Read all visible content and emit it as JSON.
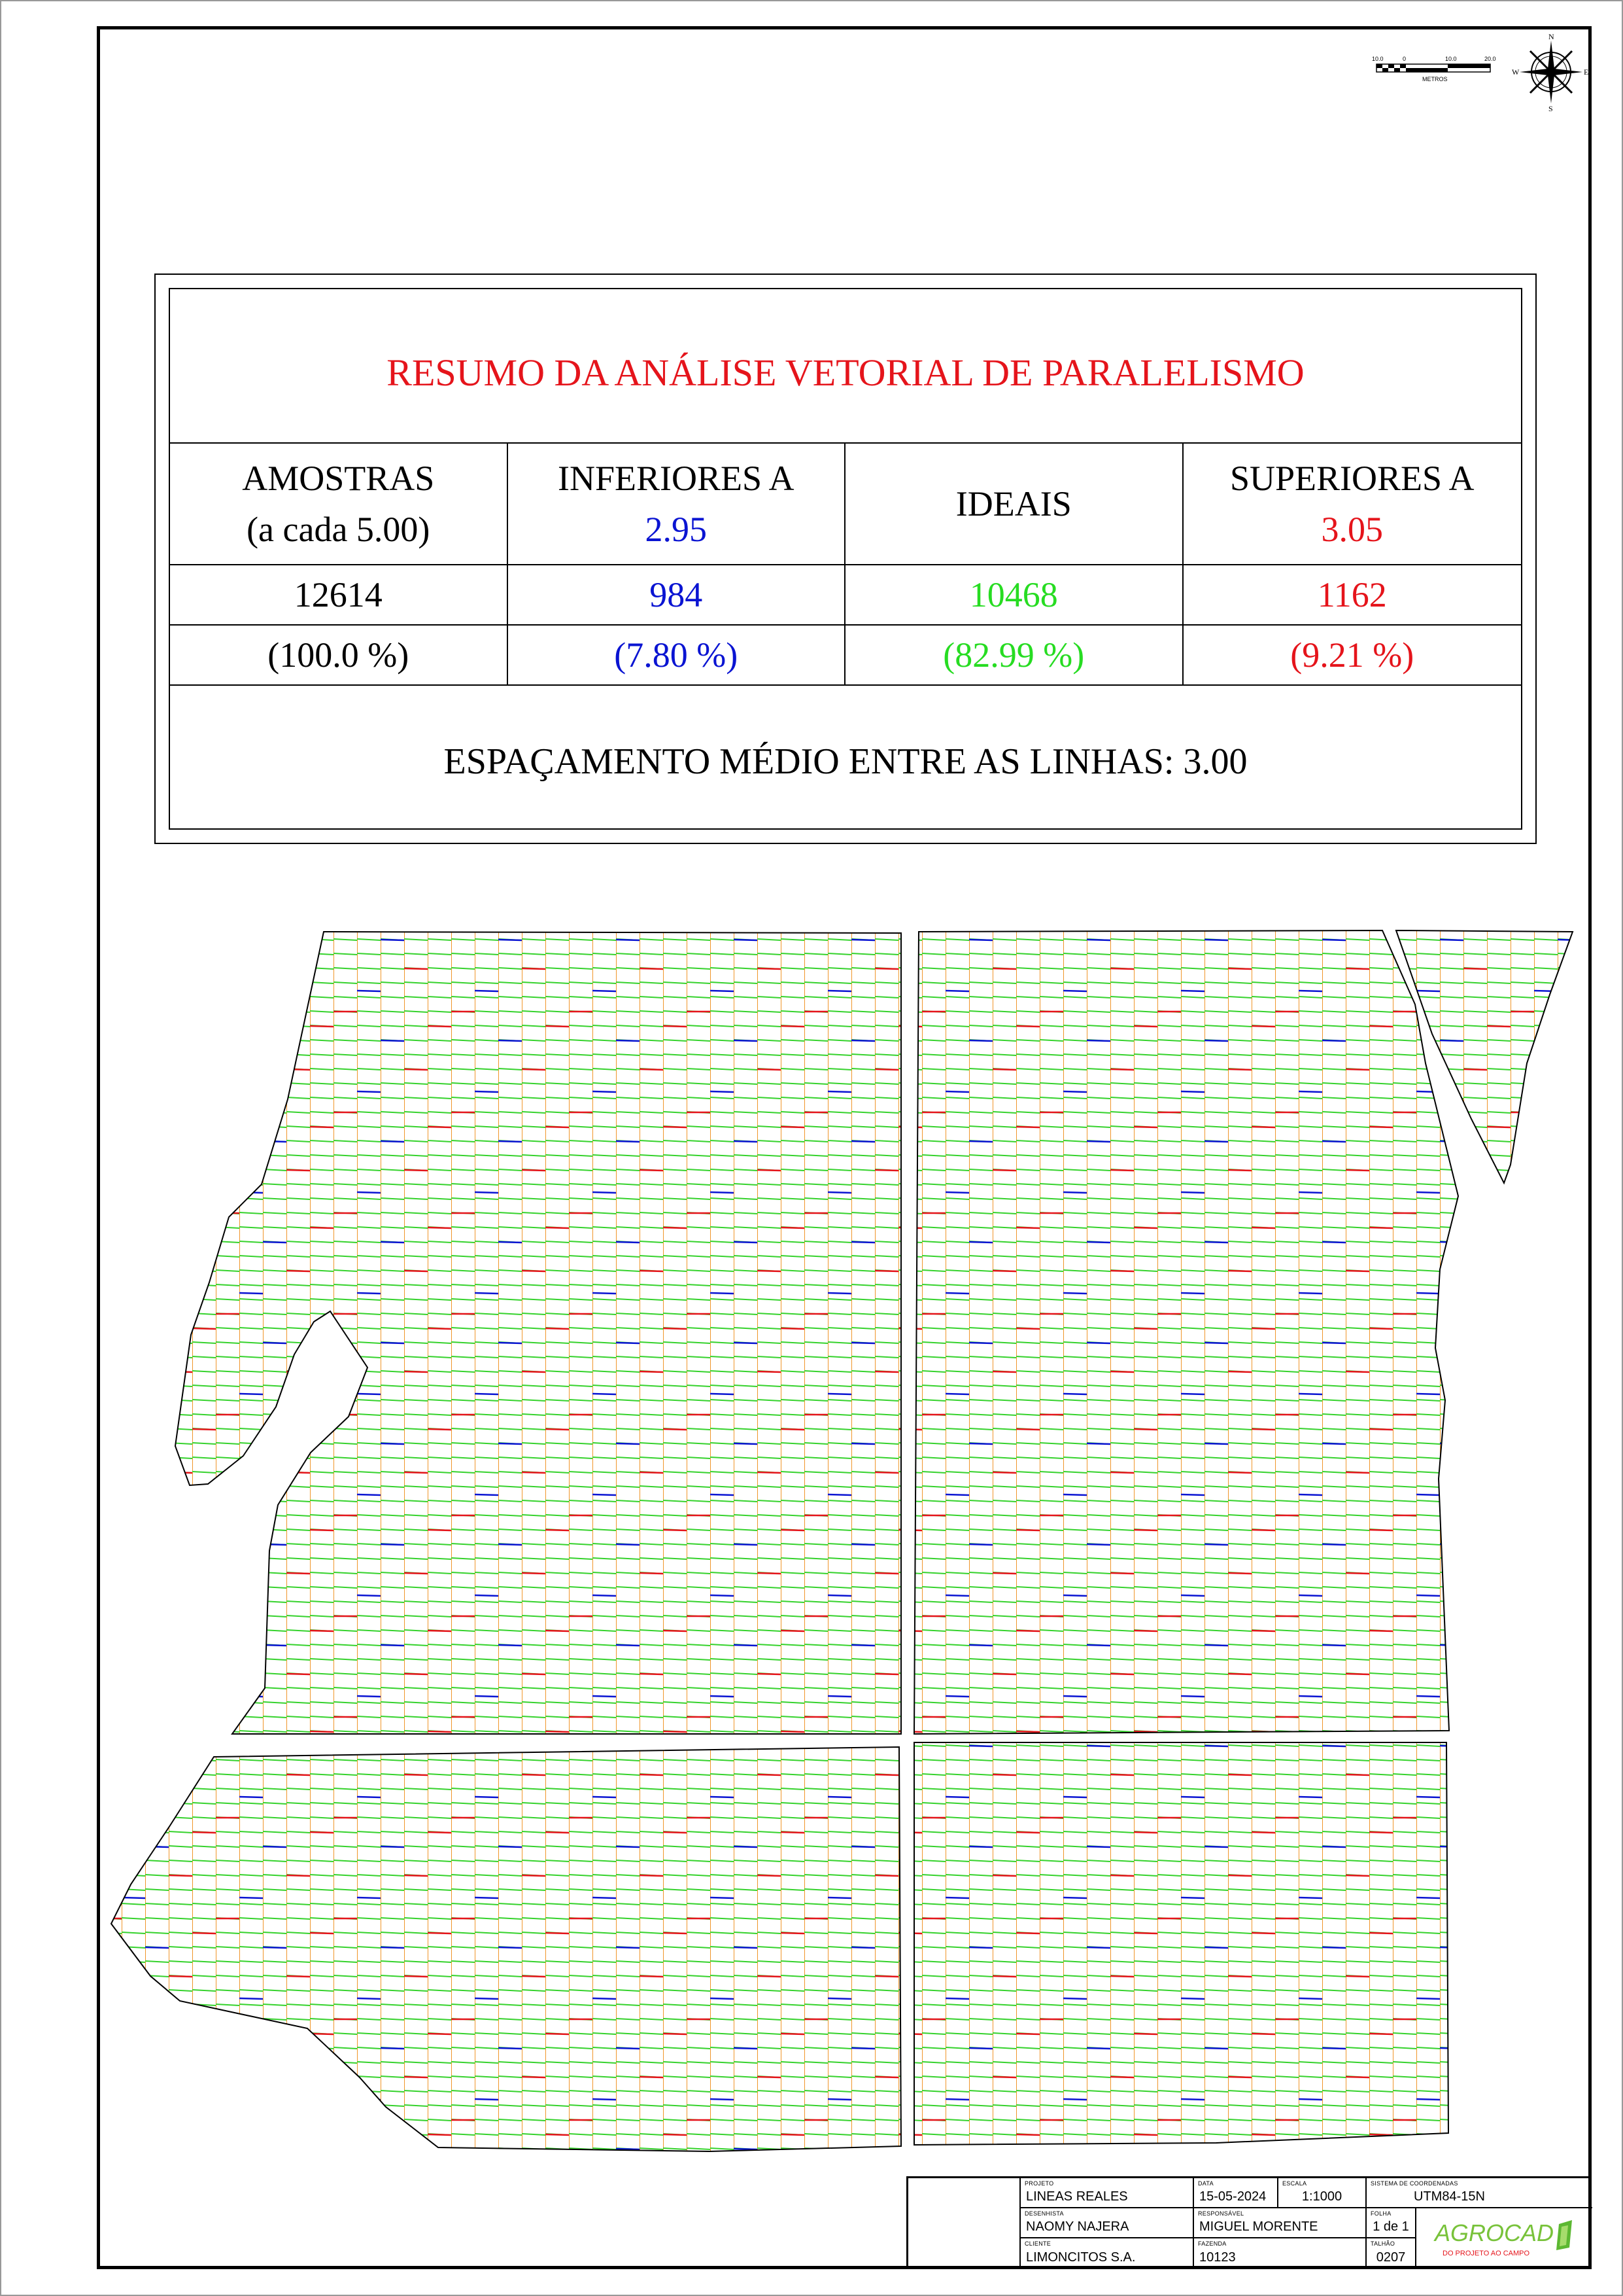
{
  "summary": {
    "title": "RESUMO DA ANÁLISE VETORIAL DE PARALELISMO",
    "headers": {
      "samples_line1": "AMOSTRAS",
      "samples_line2": "(a cada 5.00)",
      "lower_line1": "INFERIORES A",
      "lower_value": "2.95",
      "ideal": "IDEAIS",
      "upper_line1": "SUPERIORES A",
      "upper_value": "3.05"
    },
    "counts": {
      "samples": "12614",
      "lower": "984",
      "ideal": "10468",
      "upper": "1162"
    },
    "percents": {
      "samples": "(100.0 %)",
      "lower": "(7.80 %)",
      "ideal": "(82.99 %)",
      "upper": "(9.21 %)"
    },
    "average_spacing": "ESPAÇAMENTO MÉDIO ENTRE AS LINHAS:  3.00",
    "colors": {
      "lower": "#0a14d2",
      "ideal": "#27dc22",
      "upper": "#e5141b",
      "rows": "#f0962a",
      "title": "#e5141b"
    }
  },
  "scale_bar": {
    "ticks": [
      "10.0",
      "0",
      "10.0",
      "20.0"
    ],
    "unit": "METROS"
  },
  "compass": {
    "n": "N",
    "s": "S",
    "e": "E",
    "w": "W",
    "icon": "compass-rose-icon"
  },
  "title_block": {
    "projeto_label": "PROJETO",
    "projeto": "LINEAS REALES",
    "data_label": "DATA",
    "data": "15-05-2024",
    "escala_label": "ESCALA",
    "escala": "1:1000",
    "sistema_label": "SISTEMA DE COORDENADAS",
    "sistema": "UTM84-15N",
    "desenhista_label": "DESENHISTA",
    "desenhista": "NAOMY NAJERA",
    "responsavel_label": "RESPONSÁVEL",
    "responsavel": "MIGUEL MORENTE",
    "folha_label": "FOLHA",
    "folha": "1 de 1",
    "cliente_label": "CLIENTE",
    "cliente": "LIMONCITOS S.A.",
    "fazenda_label": "FAZENDA",
    "fazenda": "10123",
    "talhao_label": "TALHÃO",
    "talhao": "0207",
    "logo_text": "AGROCAD",
    "logo_tagline": "DO PROJETO AO CAMPO"
  }
}
